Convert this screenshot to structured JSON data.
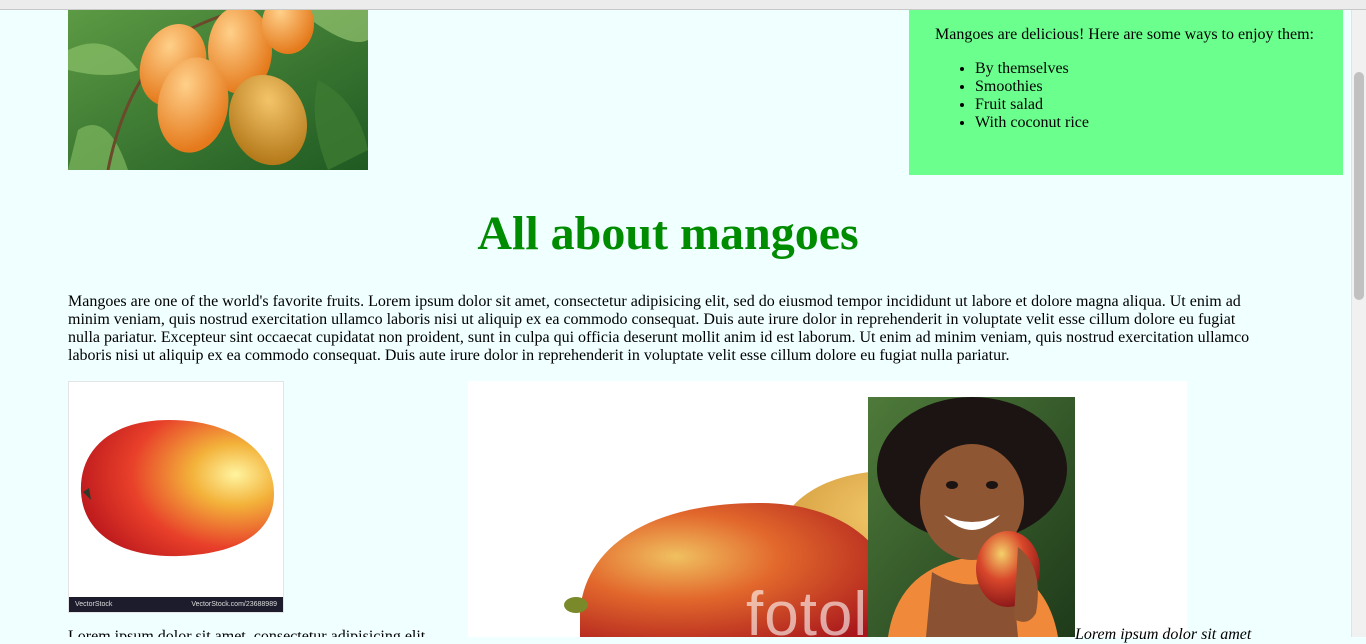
{
  "aside": {
    "intro": "Mangoes are delicious! Here are some ways to enjoy them:",
    "items": [
      "By themselves",
      "Smoothies",
      "Fruit salad",
      "With coconut rice"
    ]
  },
  "page": {
    "title": "All about mangoes",
    "intro": "Mangoes are one of the world's favorite fruits. Lorem ipsum dolor sit amet, consectetur adipisicing elit, sed do eiusmod tempor incididunt ut labore et dolore magna aliqua. Ut enim ad minim veniam, quis nostrud exercitation ullamco laboris nisi ut aliquip ex ea commodo consequat. Duis aute irure dolor in reprehenderit in voluptate velit esse cillum dolore eu fugiat nulla pariatur. Excepteur sint occaecat cupidatat non proident, sunt in culpa qui officia deserunt mollit anim id est laborum. Ut enim ad minim veniam, quis nostrud exercitation ullamco laboris nisi ut aliquip ex ea commodo consequat. Duis aute irure dolor in reprehenderit in voluptate velit esse cillum dolore eu fugiat nulla pariatur.",
    "caption": "Lorem ipsum dolor sit amet",
    "bottom_text": "Lorem ipsum dolor sit amet, consectetur adipisicing elit"
  },
  "images": {
    "vectorstock_brand": "VectorStock",
    "vectorstock_url": "VectorStock.com/23688989",
    "watermark": "fotol"
  },
  "colors": {
    "background": "#f0ffff",
    "aside": "#6bff8e",
    "heading": "#008c00"
  }
}
